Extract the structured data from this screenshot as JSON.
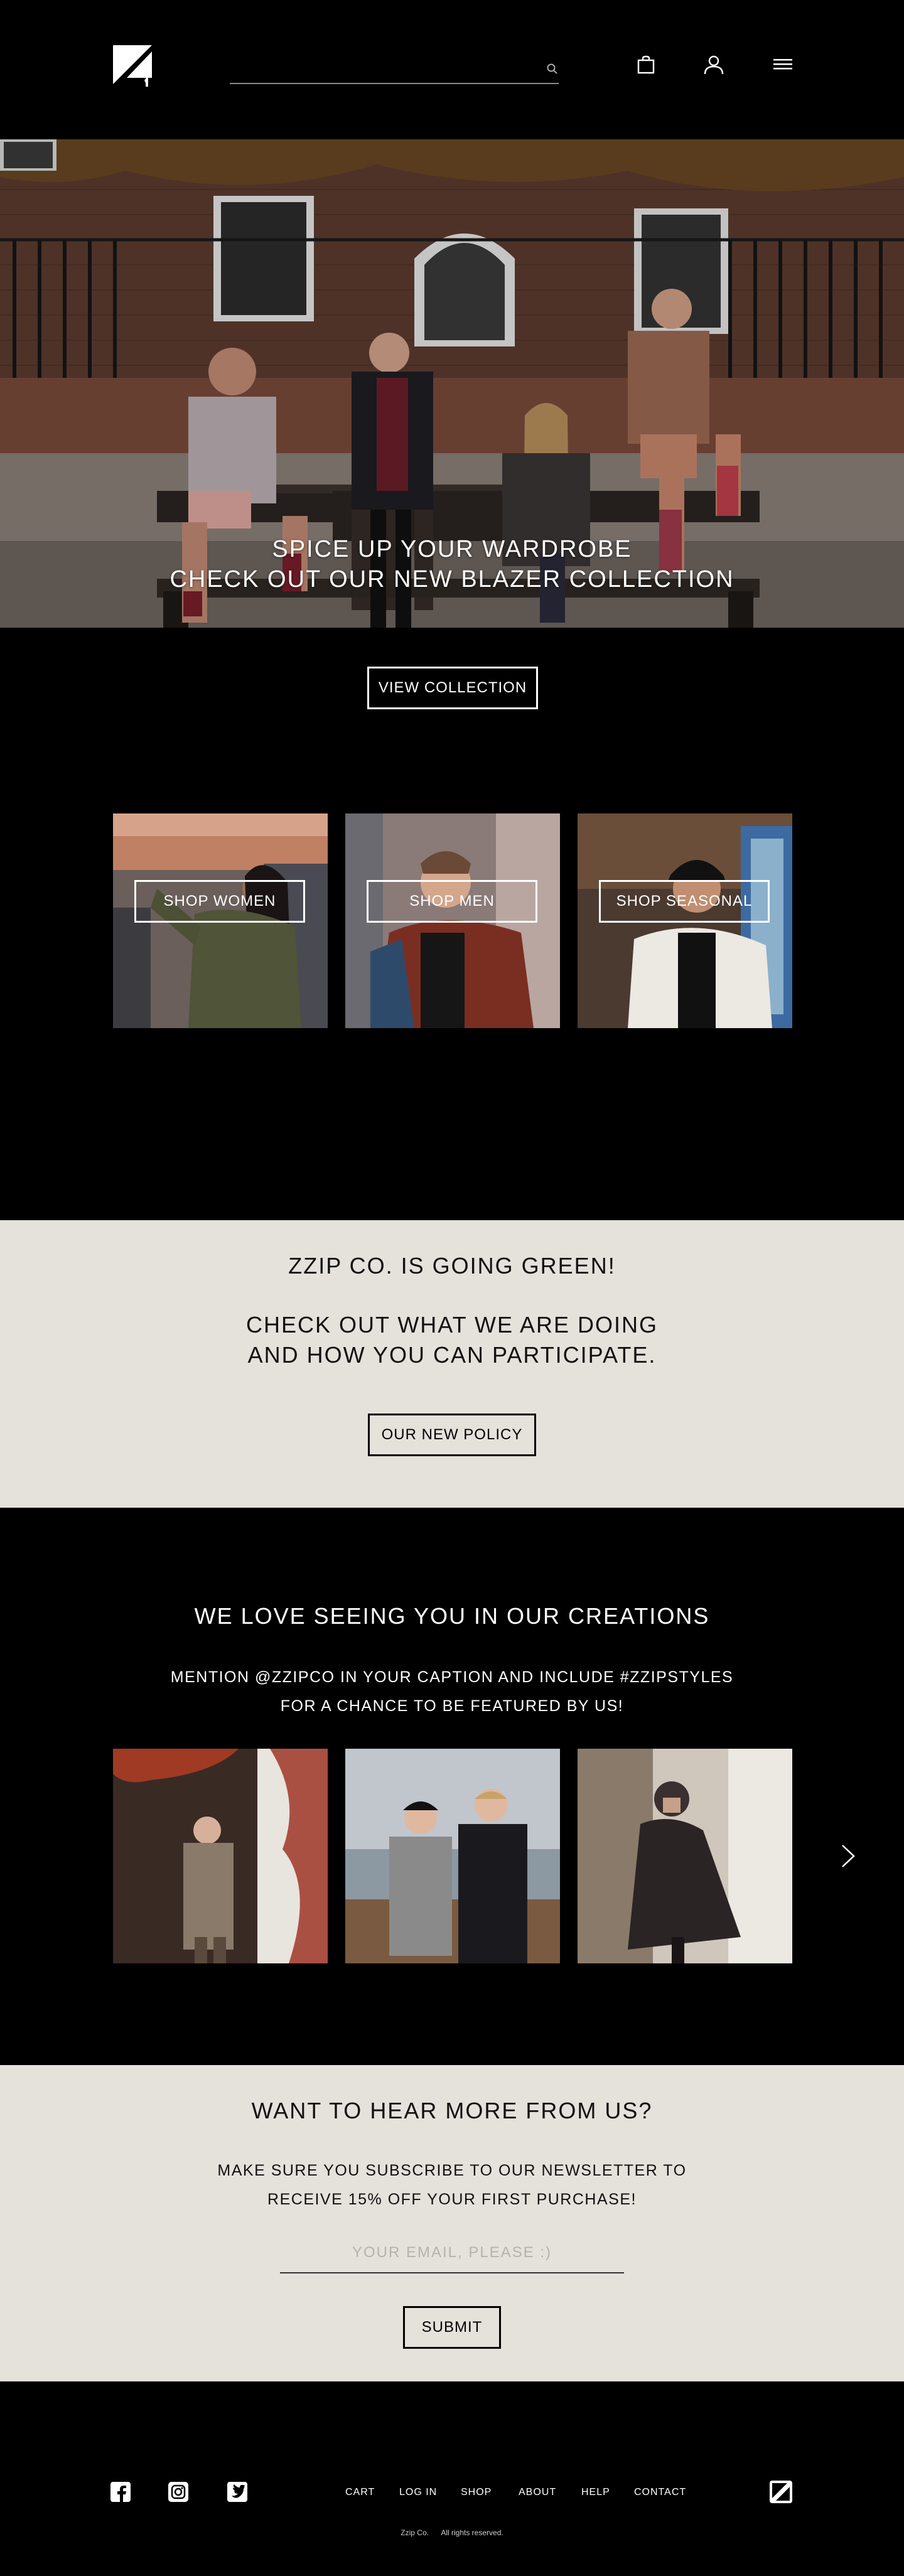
{
  "header": {
    "search_placeholder": ""
  },
  "hero": {
    "line1": "SPICE UP YOUR WARDROBE",
    "line2": "CHECK OUT OUR NEW BLAZER COLLECTION"
  },
  "collection": {
    "view_button": "VIEW COLLECTION",
    "categories": [
      {
        "label": "SHOP WOMEN"
      },
      {
        "label": "SHOP MEN"
      },
      {
        "label": "SHOP SEASONAL"
      }
    ]
  },
  "green": {
    "title": "ZZIP CO. IS GOING GREEN!",
    "line1": "CHECK OUT WHAT WE ARE DOING",
    "line2": "AND HOW YOU CAN PARTICIPATE.",
    "button": "OUR NEW POLICY"
  },
  "creations": {
    "title": "WE LOVE SEEING YOU IN OUR CREATIONS",
    "line1": "MENTION @ZZIPCO IN YOUR CAPTION AND INCLUDE #ZZIPSTYLES",
    "line2": "FOR A CHANCE TO BE FEATURED BY US!"
  },
  "newsletter": {
    "title": "WANT TO HEAR MORE FROM US?",
    "line1": "MAKE SURE YOU SUBSCRIBE TO OUR NEWSLETTER TO",
    "line2": "RECEIVE 15% OFF YOUR FIRST PURCHASE!",
    "email_placeholder": "YOUR EMAIL, PLEASE :)",
    "submit": "SUBMIT"
  },
  "footer": {
    "links": [
      "CART",
      "LOG IN",
      "SHOP",
      "ABOUT",
      "HELP",
      "CONTACT"
    ],
    "brand": "Zzip Co.",
    "rights": "All rights reserved."
  }
}
